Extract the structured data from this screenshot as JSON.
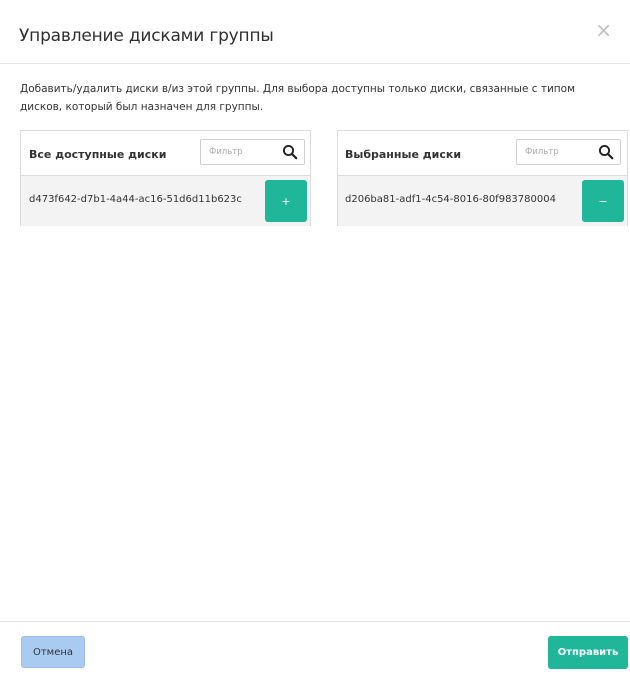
{
  "dialog": {
    "title": "Управление дисками группы",
    "close_symbol": "×",
    "description": "Добавить/удалить диски в/из этой группы. Для выбора доступны только диски, связанные с типом дисков, который был назначен для группы."
  },
  "available_panel": {
    "title": "Все доступные диски",
    "filter_placeholder": "Фильтр",
    "filter_value": "",
    "items": [
      {
        "id": "d473f642-d7b1-4a44-ac16-51d6d11b623c",
        "action_label": "+"
      }
    ]
  },
  "selected_panel": {
    "title": "Выбранные диски",
    "filter_placeholder": "Фильтр",
    "filter_value": "",
    "items": [
      {
        "id": "d206ba81-adf1-4c54-8016-80f983780004",
        "action_label": "−"
      }
    ]
  },
  "footer": {
    "cancel_label": "Отмена",
    "submit_label": "Отправить"
  },
  "colors": {
    "primary_green": "#1fb69a",
    "cancel_blue": "#aacbf1",
    "row_bg": "#f3f3f3"
  },
  "icons": {
    "filter": "search-icon",
    "close": "close-icon"
  }
}
